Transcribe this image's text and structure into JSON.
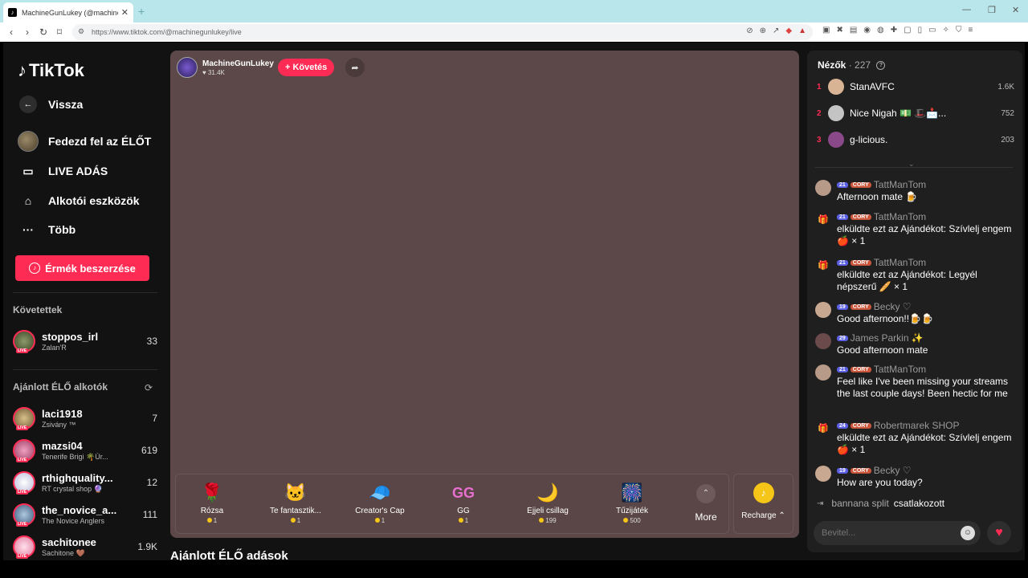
{
  "browser": {
    "tab_title": "MachineGunLukey (@machineg",
    "url": "https://www.tiktok.com/@machinegunlukey/live"
  },
  "sidebar": {
    "logo": "TikTok",
    "back_label": "Vissza",
    "nav": [
      {
        "label": "Fedezd fel az ÉLŐT"
      },
      {
        "label": "LIVE ADÁS"
      },
      {
        "label": "Alkotói eszközök"
      },
      {
        "label": "Több"
      }
    ],
    "coins_button": "Érmék beszerzése",
    "following_title": "Követettek",
    "following": [
      {
        "name": "stoppos_irl",
        "sub": "Zalan'R",
        "count": "33"
      }
    ],
    "recommended_title": "Ajánlott ÉLŐ alkotók",
    "recommended": [
      {
        "name": "laci1918",
        "sub": "Zsivány ™",
        "count": "7"
      },
      {
        "name": "mazsi04",
        "sub": "Tenerife Brigi 🌴Úr...",
        "count": "619"
      },
      {
        "name": "rthighquality...",
        "sub": "RT crystal shop 🔮",
        "count": "12"
      },
      {
        "name": "the_novice_a...",
        "sub": "The Novice Anglers",
        "count": "111"
      },
      {
        "name": "sachitonee",
        "sub": "Sachitone 🤎",
        "count": "1.9K"
      }
    ]
  },
  "stream": {
    "host_name": "MachineGunLukey",
    "host_likes": "31.4K",
    "follow_label": "+ Követés",
    "gifts": [
      {
        "name": "Rózsa",
        "price": "1",
        "icon": "🌹"
      },
      {
        "name": "Te fantasztik...",
        "price": "1",
        "icon": "🐱"
      },
      {
        "name": "Creator's Cap",
        "price": "1",
        "icon": "🧢"
      },
      {
        "name": "GG",
        "price": "1",
        "icon": "GG"
      },
      {
        "name": "Éjjeli csillag",
        "price": "199",
        "icon": "🌙"
      },
      {
        "name": "Tűzijáték",
        "price": "500",
        "icon": "🎆"
      }
    ],
    "more_label": "More",
    "recharge_label": "Recharge ⌃",
    "recommended_title": "Ajánlott ÉLŐ adások"
  },
  "chat": {
    "viewers_label": "Nézők",
    "viewers_count": "· 227",
    "top_viewers": [
      {
        "rank": "1",
        "name": "StanAVFC",
        "score": "1.6K"
      },
      {
        "rank": "2",
        "name": "Nice Nigah 💵 🎩📩...",
        "score": "752"
      },
      {
        "rank": "3",
        "name": "g-licious.",
        "score": "203"
      }
    ],
    "messages": [
      {
        "level": "21",
        "fan": "CORY",
        "user": "TattManTom",
        "text": "Afternoon mate 🍺"
      },
      {
        "level": "21",
        "fan": "CORY",
        "user": "TattManTom",
        "text": "elküldte ezt az Ajándékot: Szívlelj engem 🍎 × 1"
      },
      {
        "level": "21",
        "fan": "CORY",
        "user": "TattManTom",
        "text": "elküldte ezt az Ajándékot: Legyél népszerű 🥖 × 1"
      },
      {
        "level": "19",
        "fan": "CORY",
        "user": "Becky ♡",
        "text": "Good afternoon!!🍺🍺"
      },
      {
        "level": "29",
        "fan": "",
        "user": "James Parkin ✨",
        "text": "Good afternoon mate"
      },
      {
        "level": "21",
        "fan": "CORY",
        "user": "TattManTom",
        "text": "Feel like I've been missing your streams the last couple days! Been hectic for me"
      },
      {
        "level": "24",
        "fan": "CORY",
        "user": "Robertmarek SHOP",
        "text": "elküldte ezt az Ajándékot: Szívlelj engem 🍎 × 1"
      },
      {
        "level": "19",
        "fan": "CORY",
        "user": "Becky ♡",
        "text": "How are you today?"
      }
    ],
    "join_user": "bannana split",
    "join_text": "csatlakozott",
    "input_placeholder": "Bevitel..."
  }
}
